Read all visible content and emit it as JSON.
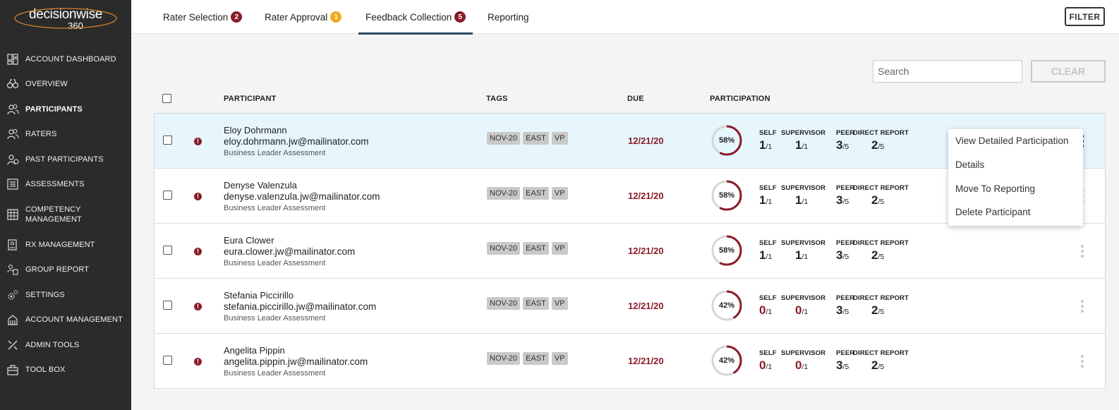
{
  "logo": {
    "brand": "decisionwise",
    "suffix": "360"
  },
  "sidebar": {
    "items": [
      {
        "label": "ACCOUNT DASHBOARD",
        "icon": "dashboard-icon",
        "active": false
      },
      {
        "label": "OVERVIEW",
        "icon": "binoculars-icon",
        "active": false
      },
      {
        "label": "PARTICIPANTS",
        "icon": "users-icon",
        "active": true
      },
      {
        "label": "RATERS",
        "icon": "users-icon",
        "active": false
      },
      {
        "label": "PAST PARTICIPANTS",
        "icon": "users-history-icon",
        "active": false
      },
      {
        "label": "ASSESSMENTS",
        "icon": "list-icon",
        "active": false
      },
      {
        "label": "COMPETENCY MANAGEMENT",
        "icon": "grid-icon",
        "active": false
      },
      {
        "label": "RX MANAGEMENT",
        "icon": "prescription-icon",
        "active": false
      },
      {
        "label": "GROUP REPORT",
        "icon": "group-report-icon",
        "active": false
      },
      {
        "label": "SETTINGS",
        "icon": "gears-icon",
        "active": false
      },
      {
        "label": "ACCOUNT MANAGEMENT",
        "icon": "building-icon",
        "active": false
      },
      {
        "label": "ADMIN TOOLS",
        "icon": "tools-icon",
        "active": false
      },
      {
        "label": "TOOL BOX",
        "icon": "toolbox-icon",
        "active": false
      }
    ]
  },
  "tabs": [
    {
      "label": "Rater Selection",
      "badge": "2",
      "badge_color": "#8b1b2a"
    },
    {
      "label": "Rater Approval",
      "badge": "1",
      "badge_color": "#f2a91e"
    },
    {
      "label": "Feedback Collection",
      "badge": "5",
      "badge_color": "#8b1b2a"
    },
    {
      "label": "Reporting",
      "badge": ""
    }
  ],
  "filter_label": "FILTER",
  "search": {
    "placeholder": "Search"
  },
  "clear_label": "CLEAR",
  "columns": {
    "participant": "PARTICIPANT",
    "tags": "TAGS",
    "due": "DUE",
    "participation": "PARTICIPATION"
  },
  "stat_labels": {
    "self": "SELF",
    "supervisor": "SUPERVISOR",
    "peer": "PEER",
    "direct_report": "DIRECT REPORT"
  },
  "rows": [
    {
      "name": "Eloy Dohrmann",
      "email": "eloy.dohrmann.jw@mailinator.com",
      "assessment": "Business Leader Assessment",
      "tags": [
        "NOV-20",
        "EAST",
        "VP"
      ],
      "due": "12/21/20",
      "participation": "58%",
      "participation_value": 0.58,
      "self": "1",
      "self_of": "/1",
      "supervisor": "1",
      "supervisor_of": "/1",
      "peer": "3",
      "peer_of": "/5",
      "direct": "2",
      "direct_of": "/5"
    },
    {
      "name": "Denyse Valenzula",
      "email": "denyse.valenzula.jw@mailinator.com",
      "assessment": "Business Leader Assessment",
      "tags": [
        "NOV-20",
        "EAST",
        "VP"
      ],
      "due": "12/21/20",
      "participation": "58%",
      "participation_value": 0.58,
      "self": "1",
      "self_of": "/1",
      "supervisor": "1",
      "supervisor_of": "/1",
      "peer": "3",
      "peer_of": "/5",
      "direct": "2",
      "direct_of": "/5"
    },
    {
      "name": "Eura Clower",
      "email": "eura.clower.jw@mailinator.com",
      "assessment": "Business Leader Assessment",
      "tags": [
        "NOV-20",
        "EAST",
        "VP"
      ],
      "due": "12/21/20",
      "participation": "58%",
      "participation_value": 0.58,
      "self": "1",
      "self_of": "/1",
      "supervisor": "1",
      "supervisor_of": "/1",
      "peer": "3",
      "peer_of": "/5",
      "direct": "2",
      "direct_of": "/5"
    },
    {
      "name": "Stefania Piccirillo",
      "email": "stefania.piccirillo.jw@mailinator.com",
      "assessment": "Business Leader Assessment",
      "tags": [
        "NOV-20",
        "EAST",
        "VP"
      ],
      "due": "12/21/20",
      "participation": "42%",
      "participation_value": 0.42,
      "self": "0",
      "self_of": "/1",
      "supervisor": "0",
      "supervisor_of": "/1",
      "peer": "3",
      "peer_of": "/5",
      "direct": "2",
      "direct_of": "/5"
    },
    {
      "name": "Angelita Pippin",
      "email": "angelita.pippin.jw@mailinator.com",
      "assessment": "Business Leader Assessment",
      "tags": [
        "NOV-20",
        "EAST",
        "VP"
      ],
      "due": "12/21/20",
      "participation": "42%",
      "participation_value": 0.42,
      "self": "0",
      "self_of": "/1",
      "supervisor": "0",
      "supervisor_of": "/1",
      "peer": "3",
      "peer_of": "/5",
      "direct": "2",
      "direct_of": "/5"
    }
  ],
  "context_menu": {
    "items": [
      "View Detailed Participation",
      "Details",
      "Move To Reporting",
      "Delete Participant"
    ]
  },
  "colors": {
    "accent_red": "#8b1b2a",
    "sidebar_bg": "#2b2b2b",
    "tab_underline": "#244a62",
    "row_highlight": "#e6f6fc"
  }
}
